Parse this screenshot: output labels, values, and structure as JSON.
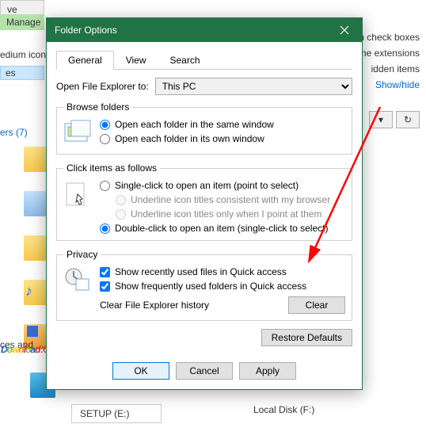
{
  "bg": {
    "ribbon_tab1": "ve Tools",
    "ribbon_tab2": "Manage",
    "medium_icons": "edium icons",
    "es": "es",
    "check_boxes": "Item check boxes",
    "name_ext": "ile name extensions",
    "hidden_items": "idden items",
    "showhide": "Show/hide",
    "side_group": "ers (7)",
    "ces_and": "ces and ...",
    "setup_drive": "SETUP (E:)",
    "local_disk": "Local Disk (F:)"
  },
  "dialog": {
    "title": "Folder Options",
    "tabs": {
      "general": "General",
      "view": "View",
      "search": "Search"
    },
    "open_label": "Open File Explorer to:",
    "open_value": "This PC",
    "browse": {
      "legend": "Browse folders",
      "opt1": "Open each folder in the same window",
      "opt2": "Open each folder in its own window"
    },
    "click": {
      "legend": "Click items as follows",
      "opt1": "Single-click to open an item (point to select)",
      "sub1": "Underline icon titles consistent with my browser",
      "sub2": "Underline icon titles only when I point at them",
      "opt2": "Double-click to open an item (single-click to select)"
    },
    "privacy": {
      "legend": "Privacy",
      "chk1": "Show recently used files in Quick access",
      "chk2": "Show frequently used folders in Quick access",
      "clear_label": "Clear File Explorer history",
      "clear_btn": "Clear"
    },
    "restore": "Restore Defaults",
    "ok": "OK",
    "cancel": "Cancel",
    "apply": "Apply"
  }
}
